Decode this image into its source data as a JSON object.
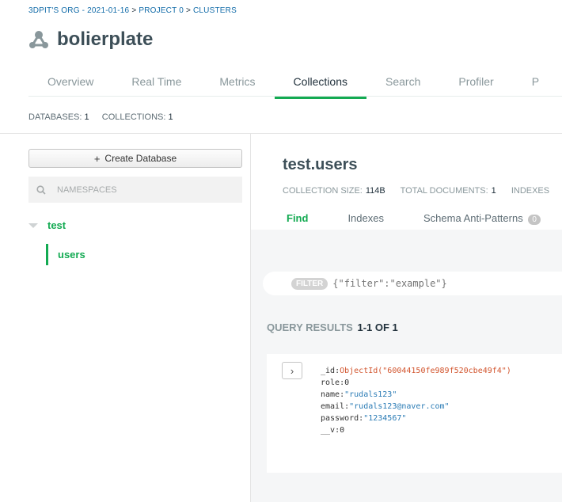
{
  "breadcrumb": {
    "items": [
      "3DPIT'S ORG - 2021-01-16",
      "PROJECT 0",
      "CLUSTERS"
    ],
    "separator": ">"
  },
  "cluster": {
    "name": "bolierplate",
    "icon": "cluster-icon"
  },
  "tabs": [
    "Overview",
    "Real Time",
    "Metrics",
    "Collections",
    "Search",
    "Profiler",
    "P"
  ],
  "active_tab": "Collections",
  "counts": {
    "databases_label": "DATABASES:",
    "databases_value": "1",
    "collections_label": "COLLECTIONS:",
    "collections_value": "1"
  },
  "sidebar": {
    "create_db_label": "Create Database",
    "create_db_icon": "plus-icon",
    "search_placeholder": "NAMESPACES",
    "search_icon": "search-icon",
    "database": {
      "name": "test",
      "expanded": true
    },
    "collection": {
      "name": "users",
      "selected": true
    }
  },
  "collection": {
    "title": "test.users",
    "size_label": "COLLECTION SIZE:",
    "size_value": "114B",
    "docs_label": "TOTAL DOCUMENTS:",
    "docs_value": "1",
    "indexes_label": "INDEXES"
  },
  "subtabs": {
    "find": "Find",
    "indexes": "Indexes",
    "schema": "Schema Anti-Patterns",
    "schema_count": "0",
    "active": "Find"
  },
  "filter": {
    "label": "FILTER",
    "placeholder": "{\"filter\":\"example\"}"
  },
  "results": {
    "label": "QUERY RESULTS",
    "range": "1-1 OF 1"
  },
  "document": {
    "expand_icon": "chevron-right-icon",
    "fields": [
      {
        "key": "_id",
        "value": "ObjectId(\"60044150fe989f520cbe49f4\")",
        "type": "oid"
      },
      {
        "key": "role",
        "value": "0",
        "type": "num"
      },
      {
        "key": "name",
        "value": "\"rudals123\"",
        "type": "str"
      },
      {
        "key": "email",
        "value": "\"rudals123@naver.com\"",
        "type": "str"
      },
      {
        "key": "password",
        "value": "\"1234567\"",
        "type": "str"
      },
      {
        "key": "__v",
        "value": "0",
        "type": "num"
      }
    ]
  },
  "colors": {
    "accent": "#13aa52",
    "link": "#116ba8",
    "oid": "#d2552e",
    "string": "#2a7bb5"
  }
}
